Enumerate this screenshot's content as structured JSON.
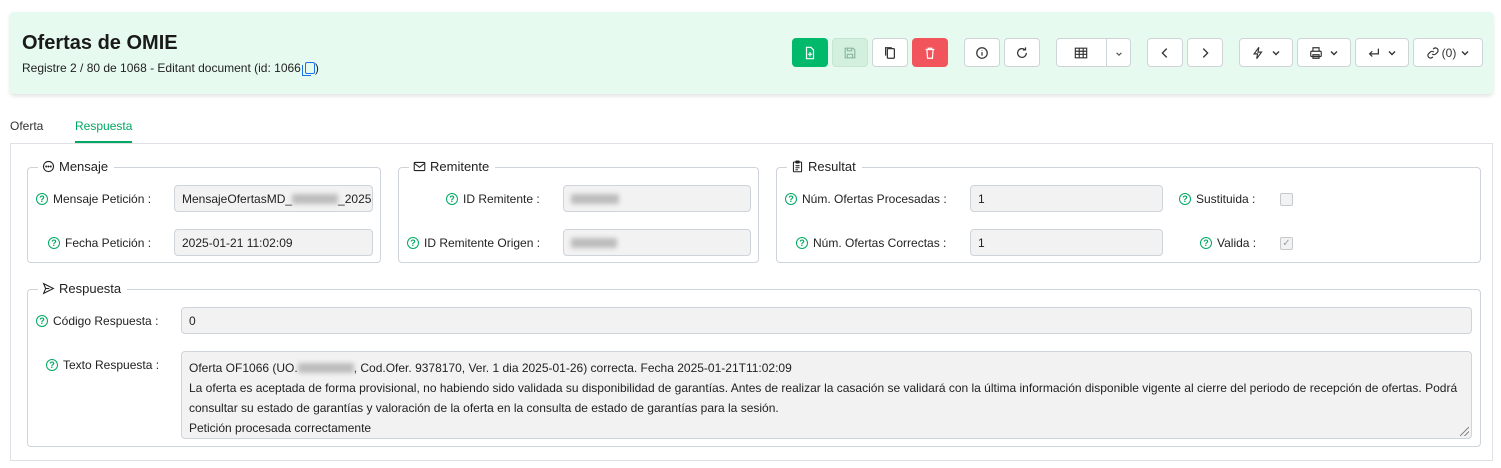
{
  "header": {
    "title": "Ofertas de OMIE",
    "subtitle": "Registre 2 / 80 de 1068 - Editant document (id: 1066"
  },
  "toolbar": {
    "links_label": "(0)"
  },
  "tabs": [
    {
      "label": "Oferta",
      "active": false
    },
    {
      "label": "Respuesta",
      "active": true
    }
  ],
  "mensaje": {
    "legend": "Mensaje",
    "peticion_label": "Mensaje Petición :",
    "peticion_value_start": "MensajeOfertasMD_",
    "peticion_value_end": "_2025",
    "fecha_label": "Fecha Petición :",
    "fecha_value": "2025-01-21 11:02:09"
  },
  "remitente": {
    "legend": "Remitente",
    "id_label": "ID Remitente :",
    "origen_label": "ID Remitente Origen :"
  },
  "resultat": {
    "legend": "Resultat",
    "procesadas_label": "Núm. Ofertas Procesadas :",
    "procesadas_value": "1",
    "correctas_label": "Núm. Ofertas Correctas :",
    "correctas_value": "1",
    "sustituida_label": "Sustituida :",
    "sustituida_checked": false,
    "valida_label": "Valida :",
    "valida_checked": true
  },
  "respuesta": {
    "legend": "Respuesta",
    "codigo_label": "Código Respuesta :",
    "codigo_value": "0",
    "texto_label": "Texto Respuesta :",
    "texto_line1_start": "Oferta OF1066 (UO.",
    "texto_line1_end": ", Cod.Ofer. 9378170, Ver. 1 dia 2025-01-26) correcta. Fecha 2025-01-21T11:02:09",
    "texto_line2": "La oferta es aceptada de forma provisional, no habiendo sido validada su disponibilidad de garantías. Antes de realizar la casación se validará con la última información disponible vigente al cierre del periodo de recepción de ofertas. Podrá",
    "texto_line3": "consultar su estado de garantías y valoración de la oferta en la consulta de estado de garantías para la sesión.",
    "texto_line4": "Petición procesada correctamente"
  },
  "colors": {
    "accent": "#00a862",
    "header_bg": "#e6faf0",
    "new_button": "#00b96b",
    "delete_button": "#f2545b"
  }
}
